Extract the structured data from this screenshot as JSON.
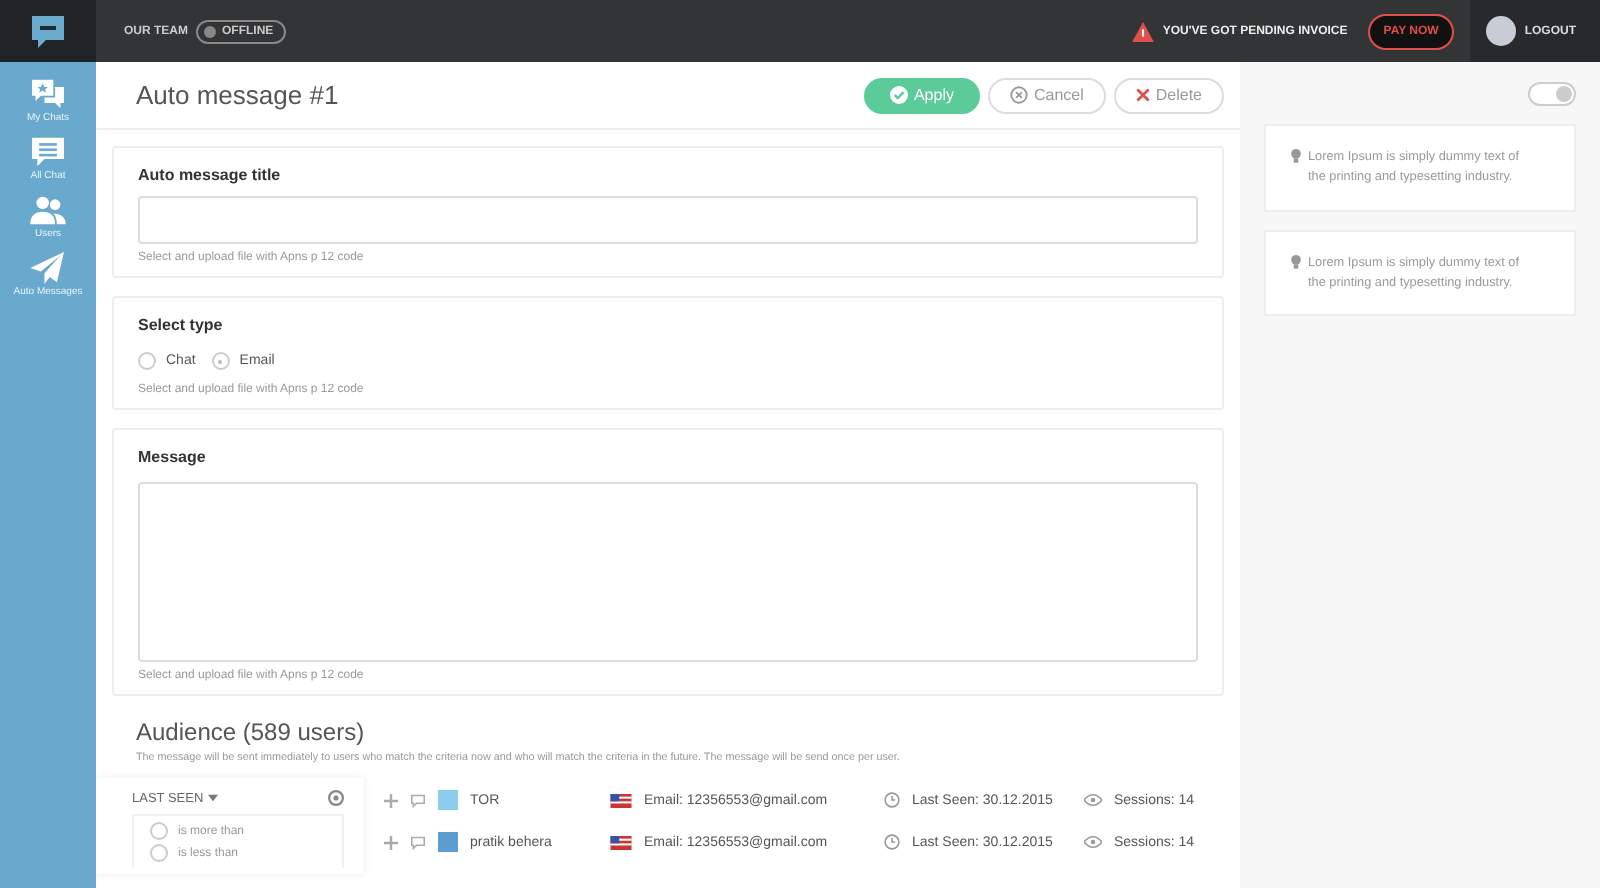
{
  "topbar": {
    "team_label": "OUR TEAM",
    "status": "OFFLINE",
    "alert": "YOU'VE GOT PENDING INVOICE",
    "pay_button": "PAY NOW",
    "logout": "LOGOUT"
  },
  "sidebar": {
    "items": [
      {
        "label": "My Chats",
        "kind": "chats"
      },
      {
        "label": "All Chat",
        "kind": "list"
      },
      {
        "label": "Users",
        "kind": "users"
      },
      {
        "label": "Auto Messages",
        "kind": "send"
      }
    ]
  },
  "header": {
    "title": "Auto message #1",
    "buttons": [
      {
        "label": "Apply",
        "kind": "apply"
      },
      {
        "label": "Cancel",
        "kind": "cancel"
      },
      {
        "label": "Delete",
        "kind": "delete"
      }
    ]
  },
  "title_card": {
    "label": "Auto message title",
    "hint": "Select and upload file with Apns p 12 code"
  },
  "type_card": {
    "label": "Select type",
    "options": [
      {
        "label": "Chat",
        "selected": false
      },
      {
        "label": "Email",
        "selected": true
      }
    ],
    "hint": "Select and upload file with Apns p 12 code"
  },
  "message_card": {
    "label": "Message",
    "hint": "Select and upload file with Apns p 12 code"
  },
  "audience": {
    "title": "Audience (589 users)",
    "description": "The message will be sent immediately to users who match the criteria now and who will match the criteria in the future. The message will be send once per user.",
    "filter": {
      "label": "LAST SEEN",
      "options": [
        {
          "label": "is more than",
          "selected": false
        },
        {
          "label": "is less than",
          "selected": false
        }
      ]
    },
    "users": [
      {
        "name": "TOR",
        "color": "#8fcbeb",
        "email": "Email: 12356553@gmail.com",
        "last_seen": "Last Seen: 30.12.2015",
        "sessions": "Sessions: 14"
      },
      {
        "name": "pratik behera",
        "color": "#5e9ccf",
        "email": "Email: 12356553@gmail.com",
        "last_seen": "Last Seen: 30.12.2015",
        "sessions": "Sessions: 14"
      }
    ]
  },
  "settings_toggle": {
    "on": true
  },
  "tips": [
    "Lorem Ipsum is simply dummy text of the printing and typesetting industry.",
    "Lorem Ipsum is simply dummy text of the printing and typesetting industry."
  ]
}
